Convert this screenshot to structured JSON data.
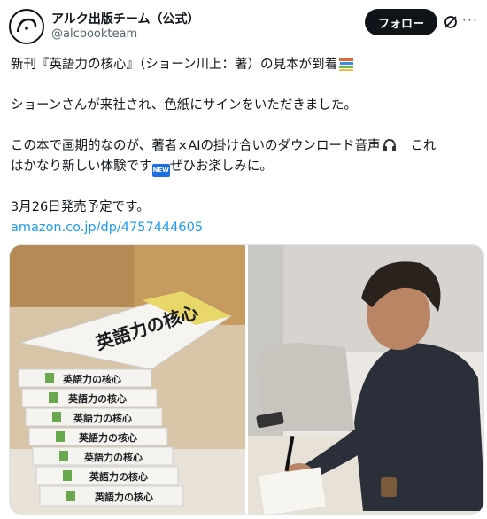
{
  "author": {
    "name": "アルク出版チーム（公式）",
    "handle": "@alcbookteam"
  },
  "actions": {
    "follow_label": "フォロー",
    "grok_icon": "grok-icon",
    "more_icon": "more-icon",
    "more_glyph": "···"
  },
  "post": {
    "line1": "新刊『英語力の核心』（ショーン川上：著）の見本が到着",
    "line2": "ショーンさんが来社され、色紙にサインをいただきました。",
    "line3a": "この本で画期的なのが、著者×AIの掛け合いのダウンロード音声",
    "line3b": "これ",
    "line4a": "はかなり新しい体験です",
    "new_badge": "NEW",
    "line4b": "ぜひお楽しみに。",
    "line5": "3月26日発売予定です。",
    "link": "amazon.co.jp/dp/4757444605"
  },
  "images": {
    "left": {
      "book_spine_title": "英語力の核心",
      "cover_title": "英語力の核心"
    }
  },
  "colors": {
    "link": "#1d9bf0",
    "follow_bg": "#0f1419",
    "handle": "#536471"
  }
}
